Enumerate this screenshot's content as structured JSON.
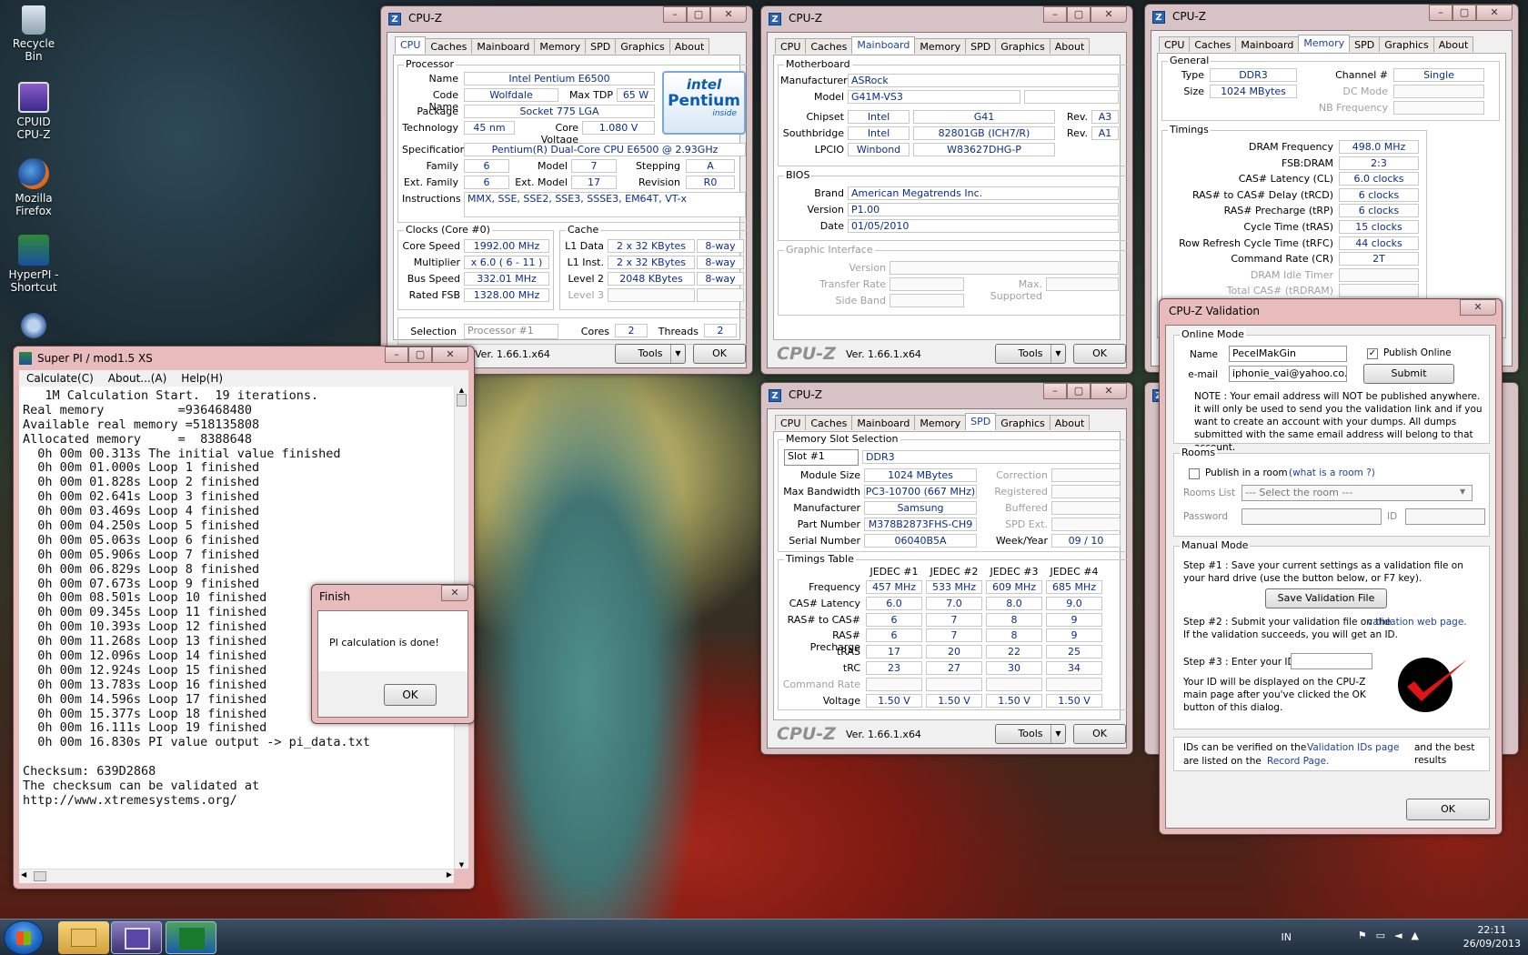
{
  "desktop": {
    "icons": [
      {
        "label": "Recycle Bin"
      },
      {
        "label": "CPUID CPU-Z"
      },
      {
        "label": "Mozilla Firefox"
      },
      {
        "label": "HyperPI - Shortcut"
      }
    ]
  },
  "cpuz_tabs": [
    "CPU",
    "Caches",
    "Mainboard",
    "Memory",
    "SPD",
    "Graphics",
    "About"
  ],
  "cpuz_common": {
    "title": "CPU-Z",
    "logo": "CPU-Z",
    "version": "Ver. 1.66.1.x64",
    "tools": "Tools",
    "ok": "OK"
  },
  "cpu": {
    "processor_group": "Processor",
    "name_label": "Name",
    "name": "Intel Pentium E6500",
    "codename_label": "Code Name",
    "codename": "Wolfdale",
    "tdp_label": "Max TDP",
    "tdp": "65 W",
    "package_label": "Package",
    "package": "Socket 775 LGA",
    "technology_label": "Technology",
    "technology": "45 nm",
    "voltage_label": "Core Voltage",
    "voltage": "1.080 V",
    "spec_label": "Specification",
    "spec": "Pentium(R) Dual-Core  CPU    E6500  @ 2.93GHz",
    "family_label": "Family",
    "family": "6",
    "model_label": "Model",
    "model": "7",
    "stepping_label": "Stepping",
    "stepping": "A",
    "extfamily_label": "Ext. Family",
    "extfamily": "6",
    "extmodel_label": "Ext. Model",
    "extmodel": "17",
    "revision_label": "Revision",
    "revision": "R0",
    "instr_label": "Instructions",
    "instr": "MMX, SSE, SSE2, SSE3, SSSE3, EM64T, VT-x",
    "badge_top": "intel",
    "badge_mid": "Pentium",
    "badge_bot": "inside",
    "clocks_group": "Clocks (Core #0)",
    "corespeed_label": "Core Speed",
    "corespeed": "1992.00 MHz",
    "multiplier_label": "Multiplier",
    "multiplier": "x 6.0 ( 6 - 11 )",
    "busspeed_label": "Bus Speed",
    "busspeed": "332.01 MHz",
    "ratedfsb_label": "Rated FSB",
    "ratedfsb": "1328.00 MHz",
    "cache_group": "Cache",
    "l1d_label": "L1 Data",
    "l1d": "2 x 32 KBytes",
    "l1d_way": "8-way",
    "l1i_label": "L1 Inst.",
    "l1i": "2 x 32 KBytes",
    "l1i_way": "8-way",
    "l2_label": "Level 2",
    "l2": "2048 KBytes",
    "l2_way": "8-way",
    "l3_label": "Level 3",
    "selection_label": "Selection",
    "selection": "Processor #1",
    "cores_label": "Cores",
    "cores": "2",
    "threads_label": "Threads",
    "threads": "2"
  },
  "mainboard": {
    "mb_group": "Motherboard",
    "manufacturer_label": "Manufacturer",
    "manufacturer": "ASRock",
    "model_label": "Model",
    "model": "G41M-VS3",
    "chipset_label": "Chipset",
    "chipset_vendor": "Intel",
    "chipset": "G41",
    "chipset_rev_label": "Rev.",
    "chipset_rev": "A3",
    "southbridge_label": "Southbridge",
    "sb_vendor": "Intel",
    "sb": "82801GB (ICH7/R)",
    "sb_rev_label": "Rev.",
    "sb_rev": "A1",
    "lpcio_label": "LPCIO",
    "lpcio_vendor": "Winbond",
    "lpcio": "W83627DHG-P",
    "bios_group": "BIOS",
    "brand_label": "Brand",
    "brand": "American Megatrends Inc.",
    "version_label": "Version",
    "version": "P1.00",
    "date_label": "Date",
    "date": "01/05/2010",
    "gi_group": "Graphic Interface",
    "gi_version_label": "Version",
    "gi_rate_label": "Transfer Rate",
    "gi_max_label": "Max. Supported",
    "gi_side_label": "Side Band"
  },
  "memory": {
    "general_group": "General",
    "type_label": "Type",
    "type": "DDR3",
    "size_label": "Size",
    "size": "1024 MBytes",
    "channel_label": "Channel #",
    "channel": "Single",
    "dc_label": "DC Mode",
    "nb_label": "NB Frequency",
    "timings_group": "Timings",
    "rows": [
      {
        "label": "DRAM Frequency",
        "value": "498.0 MHz"
      },
      {
        "label": "FSB:DRAM",
        "value": "2:3"
      },
      {
        "label": "CAS# Latency (CL)",
        "value": "6.0 clocks"
      },
      {
        "label": "RAS# to CAS# Delay (tRCD)",
        "value": "6 clocks"
      },
      {
        "label": "RAS# Precharge (tRP)",
        "value": "6 clocks"
      },
      {
        "label": "Cycle Time (tRAS)",
        "value": "15 clocks"
      },
      {
        "label": "Row Refresh Cycle Time (tRFC)",
        "value": "44 clocks"
      },
      {
        "label": "Command Rate (CR)",
        "value": "2T"
      },
      {
        "label": "DRAM Idle Timer",
        "value": ""
      },
      {
        "label": "Total CAS# (tRDRAM)",
        "value": ""
      }
    ]
  },
  "spd": {
    "slot_group": "Memory Slot Selection",
    "slot": "Slot #1",
    "ddr": "DDR3",
    "module_size_label": "Module Size",
    "module_size": "1024 MBytes",
    "bandwidth_label": "Max Bandwidth",
    "bandwidth": "PC3-10700 (667 MHz)",
    "manufacturer_label": "Manufacturer",
    "manufacturer": "Samsung",
    "part_label": "Part Number",
    "part": "M378B2873FHS-CH9",
    "serial_label": "Serial Number",
    "serial": "06040B5A",
    "correction_label": "Correction",
    "registered_label": "Registered",
    "buffered_label": "Buffered",
    "spdext_label": "SPD Ext.",
    "week_label": "Week/Year",
    "week": "09 / 10",
    "timings_group": "Timings Table",
    "headers": [
      "JEDEC #1",
      "JEDEC #2",
      "JEDEC #3",
      "JEDEC #4"
    ],
    "rows": [
      {
        "label": "Frequency",
        "values": [
          "457 MHz",
          "533 MHz",
          "609 MHz",
          "685 MHz"
        ]
      },
      {
        "label": "CAS# Latency",
        "values": [
          "6.0",
          "7.0",
          "8.0",
          "9.0"
        ]
      },
      {
        "label": "RAS# to CAS#",
        "values": [
          "6",
          "7",
          "8",
          "9"
        ]
      },
      {
        "label": "RAS# Precharge",
        "values": [
          "6",
          "7",
          "8",
          "9"
        ]
      },
      {
        "label": "tRAS",
        "values": [
          "17",
          "20",
          "22",
          "25"
        ]
      },
      {
        "label": "tRC",
        "values": [
          "23",
          "27",
          "30",
          "34"
        ]
      },
      {
        "label": "Command Rate",
        "values": [
          "",
          "",
          "",
          ""
        ]
      },
      {
        "label": "Voltage",
        "values": [
          "1.50 V",
          "1.50 V",
          "1.50 V",
          "1.50 V"
        ]
      }
    ]
  },
  "superpi": {
    "title": "Super PI / mod1.5 XS",
    "menu": [
      "Calculate(C)",
      "About...(A)",
      "Help(H)"
    ],
    "lines": [
      "   1M Calculation Start.  19 iterations.",
      "Real memory          =936468480",
      "Available real memory =518135808",
      "Allocated memory     =  8388648",
      "  0h 00m 00.313s The initial value finished",
      "  0h 00m 01.000s Loop 1 finished",
      "  0h 00m 01.828s Loop 2 finished",
      "  0h 00m 02.641s Loop 3 finished",
      "  0h 00m 03.469s Loop 4 finished",
      "  0h 00m 04.250s Loop 5 finished",
      "  0h 00m 05.063s Loop 6 finished",
      "  0h 00m 05.906s Loop 7 finished",
      "  0h 00m 06.829s Loop 8 finished",
      "  0h 00m 07.673s Loop 9 finished",
      "  0h 00m 08.501s Loop 10 finished",
      "  0h 00m 09.345s Loop 11 finished",
      "  0h 00m 10.393s Loop 12 finished",
      "  0h 00m 11.268s Loop 13 finished",
      "  0h 00m 12.096s Loop 14 finished",
      "  0h 00m 12.924s Loop 15 finished",
      "  0h 00m 13.783s Loop 16 finished",
      "  0h 00m 14.596s Loop 17 finished",
      "  0h 00m 15.377s Loop 18 finished",
      "  0h 00m 16.111s Loop 19 finished",
      "  0h 00m 16.830s PI value output -> pi_data.txt",
      "",
      "Checksum: 639D2868",
      "The checksum can be validated at",
      "http://www.xtremesystems.org/"
    ]
  },
  "finish": {
    "title": "Finish",
    "message": "PI calculation is done!",
    "ok": "OK"
  },
  "validation": {
    "title": "CPU-Z Validation",
    "online_group": "Online Mode",
    "name_label": "Name",
    "name": "PecelMakGin",
    "email_label": "e-mail",
    "email": "iphonie_vai@yahoo.co.id",
    "publish_online": "Publish Online",
    "submit": "Submit",
    "note": "NOTE : Your email address will NOT be published anywhere. it will only be used to send you the validation link and if you want to create an account with your dumps. All dumps submitted with the same email address will belong to that account.",
    "rooms_group": "Rooms",
    "publish_room": "Publish in a room",
    "room_link": "(what is a room ?)",
    "rooms_list_label": "Rooms List",
    "rooms_select": "--- Select the room ---",
    "password_label": "Password",
    "id_label": "ID",
    "manual_group": "Manual Mode",
    "step1": "Step #1 : Save your current settings as a validation file on your hard drive (use the button below, or F7 key).",
    "save_btn": "Save Validation File",
    "step2a": "Step #2 : Submit your validation file on the",
    "step2_link": "validation web page.",
    "step2b": "If the validation succeeds, you will get an ID.",
    "step3": "Step #3 : Enter your ID",
    "idinfo": "Your ID will be displayed on the CPU-Z main page after you've clicked the OK button of this dialog.",
    "ids_a": "IDs can be verified on the",
    "ids_link": "Validation IDs page",
    "ids_b": "and the best results",
    "ids_c": "are listed on the",
    "record_link": "Record Page.",
    "ok": "OK"
  },
  "taskbar": {
    "lang": "IN",
    "time": "22:11",
    "date": "26/09/2013"
  }
}
